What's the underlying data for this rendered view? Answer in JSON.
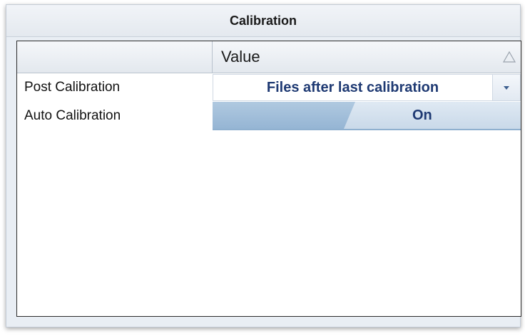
{
  "panel": {
    "title": "Calibration"
  },
  "grid": {
    "header": {
      "value_label": "Value"
    },
    "rows": [
      {
        "label": "Post Calibration",
        "value": "Files after last calibration",
        "control": "combo"
      },
      {
        "label": "Auto Calibration",
        "value": "On",
        "control": "toggle"
      }
    ]
  },
  "icons": {
    "sort": "sort-triangle-icon",
    "dropdown": "chevron-down-icon"
  },
  "colors": {
    "value_text": "#1f3a73",
    "toggle_fill": "#95b5d4",
    "panel_bg": "#e9eef4"
  }
}
